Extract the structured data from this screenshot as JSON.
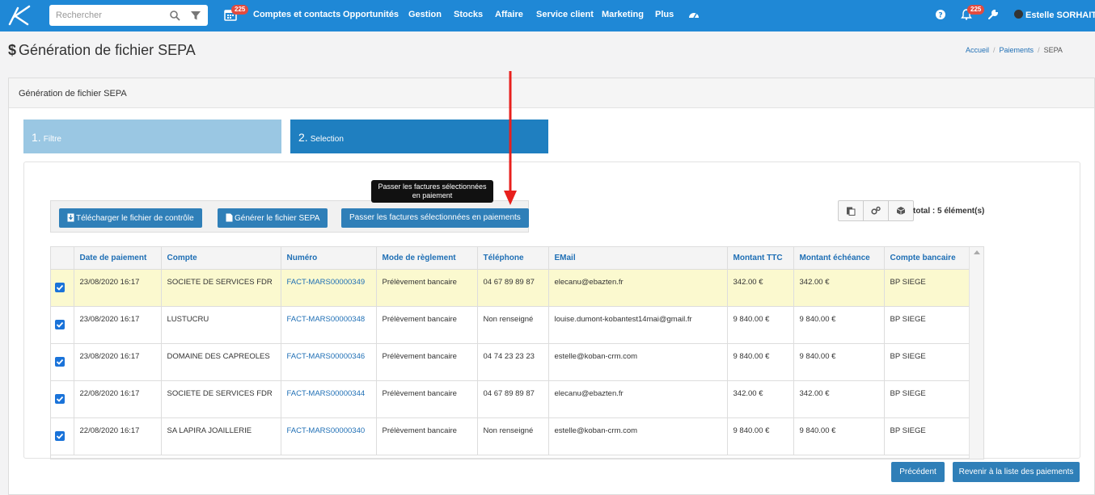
{
  "header": {
    "search_placeholder": "Rechercher",
    "calendar_badge": "225",
    "nav_items": [
      "Comptes et contacts",
      "Opportunités",
      "Gestion",
      "Stocks",
      "Affaire",
      "Service client",
      "Marketing",
      "Plus"
    ],
    "notif_badge": "225",
    "user_name": "Estelle SORHAITZ"
  },
  "page": {
    "title": "Génération de fichier SEPA",
    "breadcrumb": [
      "Accueil",
      "Paiements",
      "SEPA"
    ]
  },
  "panel": {
    "title": "Génération de fichier SEPA",
    "steps": [
      {
        "num": "1.",
        "label": "Filtre"
      },
      {
        "num": "2.",
        "label": "Selection"
      }
    ]
  },
  "toolbar": {
    "download_label": "Télécharger le fichier de contrôle",
    "generate_label": "Générer le fichier SEPA",
    "pass_label": "Passer les factures sélectionnées en paiements",
    "tooltip_line1": "Passer les factures sélectionnées",
    "tooltip_line2": "en paiement",
    "total": "total : 5 élément(s)"
  },
  "table": {
    "columns": [
      "Date de paiement",
      "Compte",
      "Numéro",
      "Mode de règlement",
      "Téléphone",
      "EMail",
      "Montant TTC",
      "Montant échéance",
      "Compte bancaire"
    ],
    "rows": [
      [
        "23/08/2020 16:17",
        "SOCIETE DE SERVICES FDR",
        "FACT-MARS00000349",
        "Prélèvement bancaire",
        "04 67 89 89 87",
        "elecanu@ebazten.fr",
        "342.00 €",
        "342.00 €",
        "BP SIEGE"
      ],
      [
        "23/08/2020 16:17",
        "LUSTUCRU",
        "FACT-MARS00000348",
        "Prélèvement bancaire",
        "Non renseigné",
        "louise.dumont-kobantest14mai@gmail.fr",
        "9 840.00 €",
        "9 840.00 €",
        "BP SIEGE"
      ],
      [
        "23/08/2020 16:17",
        "DOMAINE DES CAPREOLES",
        "FACT-MARS00000346",
        "Prélèvement bancaire",
        "04 74 23 23 23",
        "estelle@koban-crm.com",
        "9 840.00 €",
        "9 840.00 €",
        "BP SIEGE"
      ],
      [
        "22/08/2020 16:17",
        "SOCIETE DE SERVICES FDR",
        "FACT-MARS00000344",
        "Prélèvement bancaire",
        "04 67 89 89 87",
        "elecanu@ebazten.fr",
        "342.00 €",
        "342.00 €",
        "BP SIEGE"
      ],
      [
        "22/08/2020 16:17",
        "SA LAPIRA JOAILLERIE",
        "FACT-MARS00000340",
        "Prélèvement bancaire",
        "Non renseigné",
        "estelle@koban-crm.com",
        "9 840.00 €",
        "9 840.00 €",
        "BP SIEGE"
      ]
    ]
  },
  "footer": {
    "prev_label": "Précédent",
    "back_label": "Revenir à la liste des paiements"
  },
  "colors": {
    "nav_bg": "#1f88d6",
    "primary_btn": "#2f7fb8",
    "step_active": "#1f7fc0",
    "step_inactive": "#9ac7e3",
    "row_highlight": "#fbf9cf",
    "annotation_arrow": "#e8201d"
  }
}
